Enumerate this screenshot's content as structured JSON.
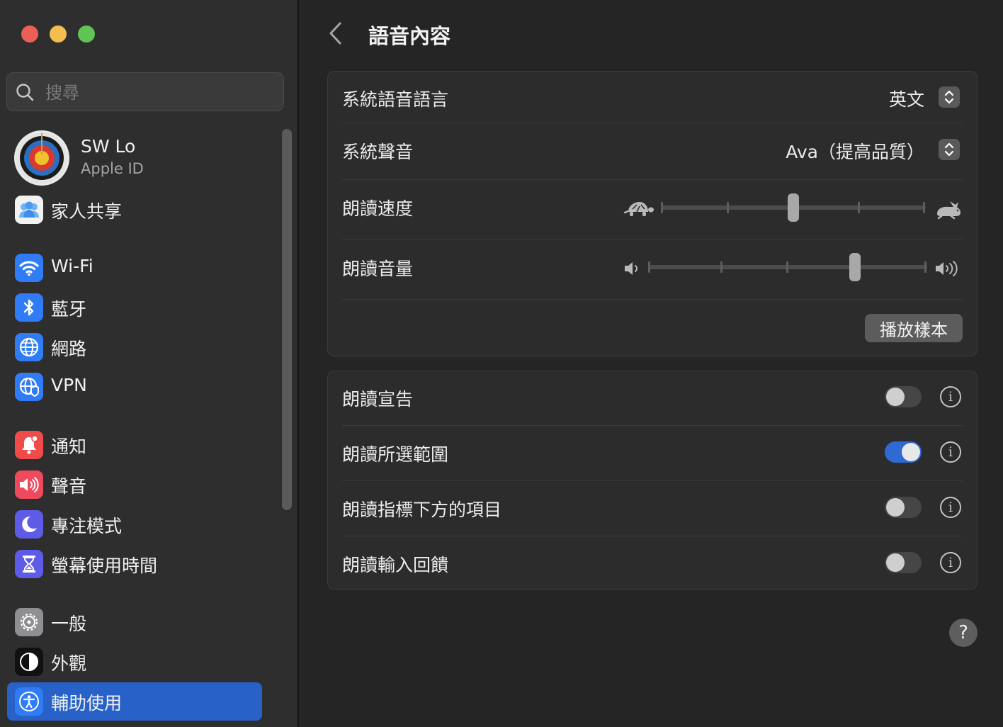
{
  "window": {
    "title": "語音內容"
  },
  "sidebar": {
    "search_placeholder": "搜尋",
    "profile": {
      "name": "SW Lo",
      "subtitle": "Apple ID"
    },
    "family": "家人共享",
    "groups": [
      [
        {
          "label": "Wi-Fi",
          "icon": "wifi-icon",
          "color": "#2f7cf6"
        },
        {
          "label": "藍牙",
          "icon": "bluetooth-icon",
          "color": "#2f7cf6"
        },
        {
          "label": "網路",
          "icon": "globe-icon",
          "color": "#2f7cf6"
        },
        {
          "label": "VPN",
          "icon": "vpn-globe-icon",
          "color": "#2f7cf6"
        }
      ],
      [
        {
          "label": "通知",
          "icon": "bell-icon",
          "color": "#ef4b4b"
        },
        {
          "label": "聲音",
          "icon": "speaker-icon",
          "color": "#ee4a5e"
        },
        {
          "label": "專注模式",
          "icon": "moon-icon",
          "color": "#5e5ce6"
        },
        {
          "label": "螢幕使用時間",
          "icon": "hourglass-icon",
          "color": "#5e5ce6"
        }
      ],
      [
        {
          "label": "一般",
          "icon": "gear-icon",
          "color": "#8e8e93"
        },
        {
          "label": "外觀",
          "icon": "appearance-icon",
          "color": "#111111"
        },
        {
          "label": "輔助使用",
          "icon": "accessibility-icon",
          "color": "#2f7cf6",
          "selected": true
        }
      ]
    ]
  },
  "main": {
    "title": "語音內容",
    "voice_panel": {
      "language_label": "系統語音語言",
      "language_value": "英文",
      "voice_label": "系統聲音",
      "voice_value": "Ava（提高品質）",
      "rate_label": "朗讀速度",
      "rate_level": 0.5,
      "volume_label": "朗讀音量",
      "volume_level": 0.75,
      "play_button": "播放樣本"
    },
    "options": [
      {
        "label": "朗讀宣告",
        "on": false
      },
      {
        "label": "朗讀所選範圍",
        "on": true
      },
      {
        "label": "朗讀指標下方的項目",
        "on": false
      },
      {
        "label": "朗讀輸入回饋",
        "on": false
      }
    ],
    "help": "?"
  }
}
